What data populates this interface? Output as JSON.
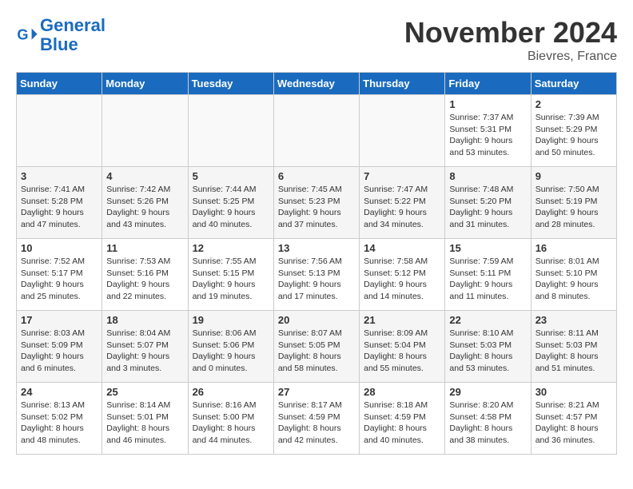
{
  "header": {
    "logo_line1": "General",
    "logo_line2": "Blue",
    "month": "November 2024",
    "location": "Bievres, France"
  },
  "weekdays": [
    "Sunday",
    "Monday",
    "Tuesday",
    "Wednesday",
    "Thursday",
    "Friday",
    "Saturday"
  ],
  "weeks": [
    [
      {
        "day": "",
        "info": ""
      },
      {
        "day": "",
        "info": ""
      },
      {
        "day": "",
        "info": ""
      },
      {
        "day": "",
        "info": ""
      },
      {
        "day": "",
        "info": ""
      },
      {
        "day": "1",
        "info": "Sunrise: 7:37 AM\nSunset: 5:31 PM\nDaylight: 9 hours\nand 53 minutes."
      },
      {
        "day": "2",
        "info": "Sunrise: 7:39 AM\nSunset: 5:29 PM\nDaylight: 9 hours\nand 50 minutes."
      }
    ],
    [
      {
        "day": "3",
        "info": "Sunrise: 7:41 AM\nSunset: 5:28 PM\nDaylight: 9 hours\nand 47 minutes."
      },
      {
        "day": "4",
        "info": "Sunrise: 7:42 AM\nSunset: 5:26 PM\nDaylight: 9 hours\nand 43 minutes."
      },
      {
        "day": "5",
        "info": "Sunrise: 7:44 AM\nSunset: 5:25 PM\nDaylight: 9 hours\nand 40 minutes."
      },
      {
        "day": "6",
        "info": "Sunrise: 7:45 AM\nSunset: 5:23 PM\nDaylight: 9 hours\nand 37 minutes."
      },
      {
        "day": "7",
        "info": "Sunrise: 7:47 AM\nSunset: 5:22 PM\nDaylight: 9 hours\nand 34 minutes."
      },
      {
        "day": "8",
        "info": "Sunrise: 7:48 AM\nSunset: 5:20 PM\nDaylight: 9 hours\nand 31 minutes."
      },
      {
        "day": "9",
        "info": "Sunrise: 7:50 AM\nSunset: 5:19 PM\nDaylight: 9 hours\nand 28 minutes."
      }
    ],
    [
      {
        "day": "10",
        "info": "Sunrise: 7:52 AM\nSunset: 5:17 PM\nDaylight: 9 hours\nand 25 minutes."
      },
      {
        "day": "11",
        "info": "Sunrise: 7:53 AM\nSunset: 5:16 PM\nDaylight: 9 hours\nand 22 minutes."
      },
      {
        "day": "12",
        "info": "Sunrise: 7:55 AM\nSunset: 5:15 PM\nDaylight: 9 hours\nand 19 minutes."
      },
      {
        "day": "13",
        "info": "Sunrise: 7:56 AM\nSunset: 5:13 PM\nDaylight: 9 hours\nand 17 minutes."
      },
      {
        "day": "14",
        "info": "Sunrise: 7:58 AM\nSunset: 5:12 PM\nDaylight: 9 hours\nand 14 minutes."
      },
      {
        "day": "15",
        "info": "Sunrise: 7:59 AM\nSunset: 5:11 PM\nDaylight: 9 hours\nand 11 minutes."
      },
      {
        "day": "16",
        "info": "Sunrise: 8:01 AM\nSunset: 5:10 PM\nDaylight: 9 hours\nand 8 minutes."
      }
    ],
    [
      {
        "day": "17",
        "info": "Sunrise: 8:03 AM\nSunset: 5:09 PM\nDaylight: 9 hours\nand 6 minutes."
      },
      {
        "day": "18",
        "info": "Sunrise: 8:04 AM\nSunset: 5:07 PM\nDaylight: 9 hours\nand 3 minutes."
      },
      {
        "day": "19",
        "info": "Sunrise: 8:06 AM\nSunset: 5:06 PM\nDaylight: 9 hours\nand 0 minutes."
      },
      {
        "day": "20",
        "info": "Sunrise: 8:07 AM\nSunset: 5:05 PM\nDaylight: 8 hours\nand 58 minutes."
      },
      {
        "day": "21",
        "info": "Sunrise: 8:09 AM\nSunset: 5:04 PM\nDaylight: 8 hours\nand 55 minutes."
      },
      {
        "day": "22",
        "info": "Sunrise: 8:10 AM\nSunset: 5:03 PM\nDaylight: 8 hours\nand 53 minutes."
      },
      {
        "day": "23",
        "info": "Sunrise: 8:11 AM\nSunset: 5:03 PM\nDaylight: 8 hours\nand 51 minutes."
      }
    ],
    [
      {
        "day": "24",
        "info": "Sunrise: 8:13 AM\nSunset: 5:02 PM\nDaylight: 8 hours\nand 48 minutes."
      },
      {
        "day": "25",
        "info": "Sunrise: 8:14 AM\nSunset: 5:01 PM\nDaylight: 8 hours\nand 46 minutes."
      },
      {
        "day": "26",
        "info": "Sunrise: 8:16 AM\nSunset: 5:00 PM\nDaylight: 8 hours\nand 44 minutes."
      },
      {
        "day": "27",
        "info": "Sunrise: 8:17 AM\nSunset: 4:59 PM\nDaylight: 8 hours\nand 42 minutes."
      },
      {
        "day": "28",
        "info": "Sunrise: 8:18 AM\nSunset: 4:59 PM\nDaylight: 8 hours\nand 40 minutes."
      },
      {
        "day": "29",
        "info": "Sunrise: 8:20 AM\nSunset: 4:58 PM\nDaylight: 8 hours\nand 38 minutes."
      },
      {
        "day": "30",
        "info": "Sunrise: 8:21 AM\nSunset: 4:57 PM\nDaylight: 8 hours\nand 36 minutes."
      }
    ]
  ]
}
